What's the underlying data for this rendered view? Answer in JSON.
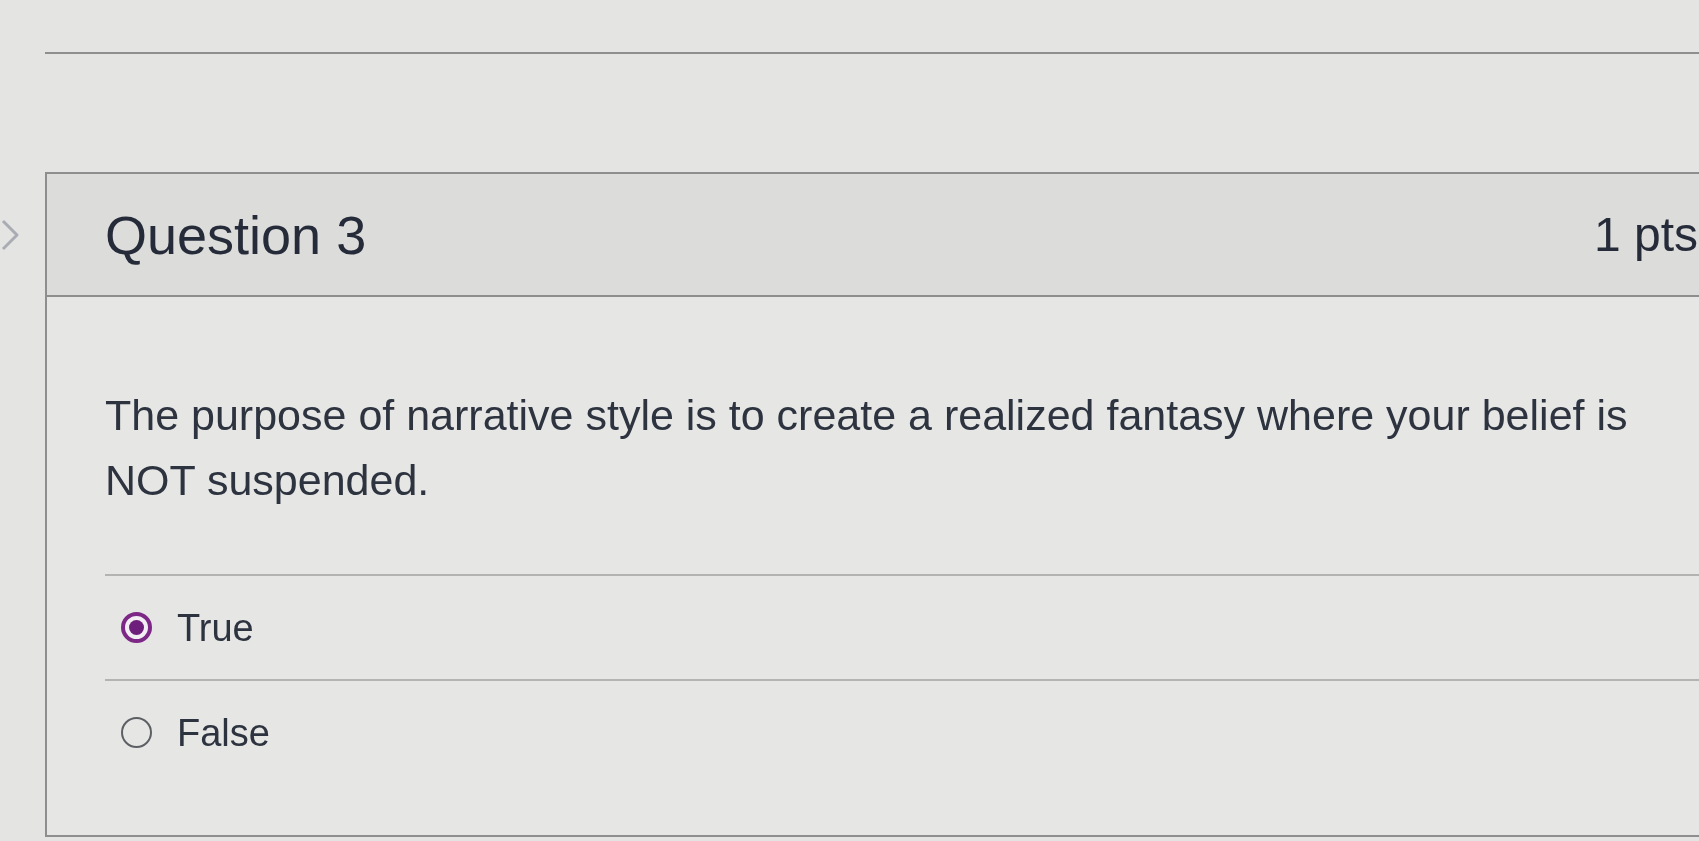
{
  "question": {
    "title": "Question 3",
    "points": "1 pts",
    "text": "The purpose of narrative style is to create a realized fantasy where your belief is NOT suspended.",
    "answers": [
      {
        "label": "True",
        "selected": true
      },
      {
        "label": "False",
        "selected": false
      }
    ]
  }
}
